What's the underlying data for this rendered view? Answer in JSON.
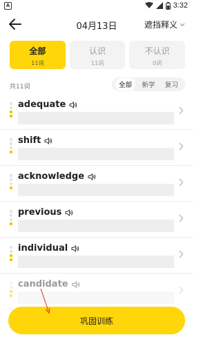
{
  "status": {
    "time": "3:32",
    "app_badge": "A"
  },
  "nav": {
    "title": "04月13日",
    "mask_label": "遮挡释义"
  },
  "tabs": [
    {
      "label": "全部",
      "count": "11词"
    },
    {
      "label": "认识",
      "count": "11词"
    },
    {
      "label": "不认识",
      "count": "0词"
    }
  ],
  "total": "共11词",
  "filters": [
    "全部",
    "新学",
    "复习"
  ],
  "words": [
    {
      "word": "adequate",
      "level": 2
    },
    {
      "word": "shift",
      "level": 1
    },
    {
      "word": "acknowledge",
      "level": 1
    },
    {
      "word": "previous",
      "level": 1
    },
    {
      "word": "individual",
      "level": 2
    },
    {
      "word": "candidate",
      "level": 2
    }
  ],
  "train_button": "巩固训练",
  "colors": {
    "accent": "#ffd60a",
    "dot_on": "#f2c400"
  }
}
